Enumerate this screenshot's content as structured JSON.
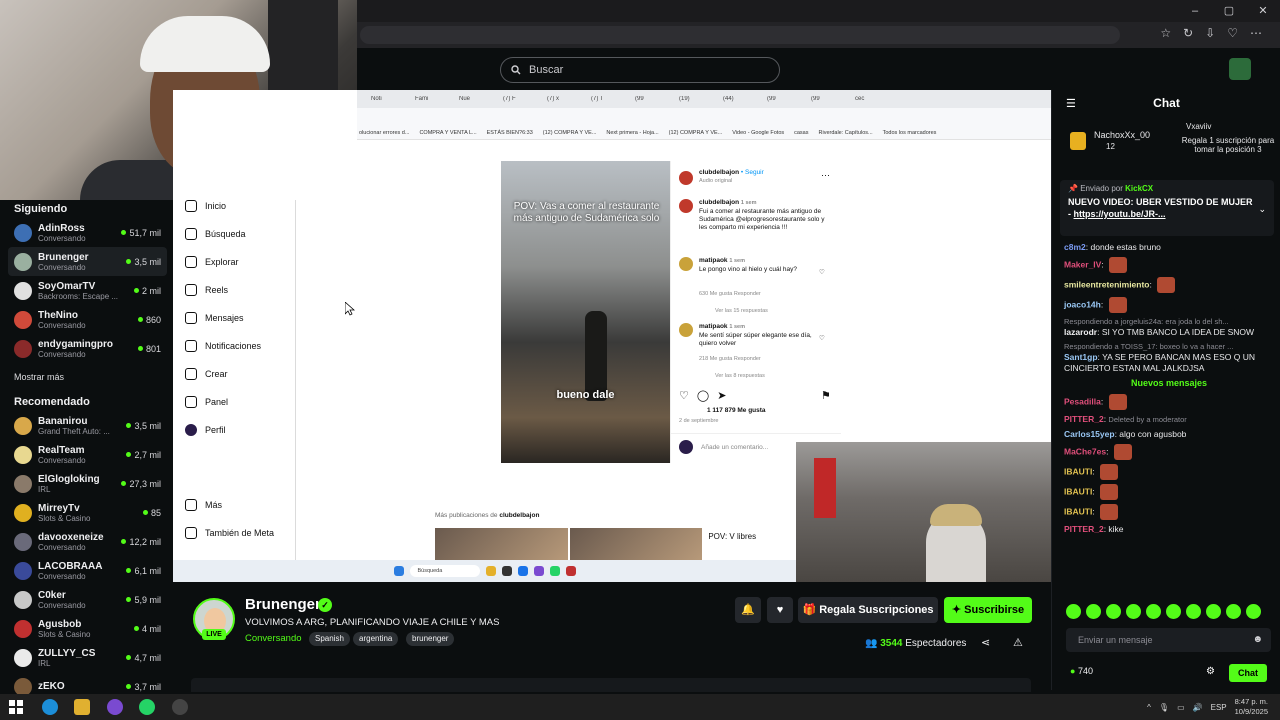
{
  "browser": {
    "window_controls": [
      "–",
      "▢",
      "✕"
    ],
    "toolbar_icons": [
      "☆",
      "↻",
      "⇩",
      "♡",
      "⋯"
    ]
  },
  "header": {
    "search_placeholder": "Buscar"
  },
  "sidebar": {
    "following_title": "Siguiendo",
    "following": [
      {
        "name": "AdinRoss",
        "category": "Conversando",
        "viewers": "51,7 mil",
        "color": "#3d6fb4"
      },
      {
        "name": "Brunenger",
        "category": "Conversando",
        "viewers": "3,5 mil",
        "color": "#9ab0a0"
      },
      {
        "name": "SoyOmarTV",
        "category": "Backrooms: Escape ...",
        "viewers": "2 mil",
        "color": "#e0e0e0"
      },
      {
        "name": "TheNino",
        "category": "Conversando",
        "viewers": "860",
        "color": "#d04a3a"
      },
      {
        "name": "endygamingpro",
        "category": "Conversando",
        "viewers": "801",
        "color": "#8a2a2a"
      }
    ],
    "show_more": "Mostrar más",
    "recommended_title": "Recomendado",
    "recommended": [
      {
        "name": "Bananirou",
        "category": "Grand Theft Auto: ...",
        "viewers": "3,5 mil",
        "color": "#d8a84a"
      },
      {
        "name": "RealTeam",
        "category": "Conversando",
        "viewers": "2,7 mil",
        "color": "#e8d890"
      },
      {
        "name": "ElGlogloking",
        "category": "IRL",
        "viewers": "27,3 mil",
        "color": "#8a7a6a"
      },
      {
        "name": "MirreyTv",
        "category": "Slots & Casino",
        "viewers": "85",
        "color": "#e0b020"
      },
      {
        "name": "davooxeneize",
        "category": "Conversando",
        "viewers": "12,2 mil",
        "color": "#6a6a7a"
      },
      {
        "name": "LACOBRAAA",
        "category": "Conversando",
        "viewers": "6,1 mil",
        "color": "#3a4a9a"
      },
      {
        "name": "C0ker",
        "category": "Conversando",
        "viewers": "5,9 mil",
        "color": "#c8c8c8"
      },
      {
        "name": "Agusbob",
        "category": "Slots & Casino",
        "viewers": "4 mil",
        "color": "#c03030"
      },
      {
        "name": "ZULLYY_CS",
        "category": "IRL",
        "viewers": "4,7 mil",
        "color": "#eaeaea"
      },
      {
        "name": "zEKO",
        "category": "",
        "viewers": "3,7 mil",
        "color": "#7a5a3a"
      }
    ]
  },
  "instagram": {
    "tabs": [
      "Noti",
      "Fami",
      "Nue",
      "(7) F",
      "(7) x",
      "(7) T",
      "(99",
      "(19)",
      "(44)",
      "(99",
      "(99",
      "cec"
    ],
    "bookmarks": [
      "olucionar errores d...",
      "COMPRA Y VENTA L...",
      "ESTÁS BIEN?6:33",
      "(12) COMPRA Y VE...",
      "Next primera - Hoja...",
      "(12) COMPRA Y VE...",
      "Video - Google Fotos",
      "casas",
      "Riverdale: Capítulos...",
      "Todos los marcadores"
    ],
    "nav": [
      "Inicio",
      "Búsqueda",
      "Explorar",
      "Reels",
      "Mensajes",
      "Notificaciones",
      "Crear",
      "Panel",
      "Perfil",
      "Más",
      "También de Meta"
    ],
    "reel_caption": "POV: Vas a comer al restaurante más antiguo de Sudamérica solo",
    "reel_subtitle": "bueno dale",
    "post": {
      "account": "clubdelbajon",
      "follow": "Seguir",
      "audio": "Audio original",
      "c1_user": "clubdelbajon",
      "c1_time": "1 sem",
      "c1_text": "Fui a comer al restaurante más antiguo de Sudamérica @elprogresorestaurante solo y les comparto mi experiencia !!!",
      "c2_user": "matipaok",
      "c2_time": "1 sem",
      "c2_text": "Le pongo vino al hielo y cuál hay?",
      "c2_meta": "630 Me gusta     Responder",
      "c2_replies": "Ver las 15 respuestas",
      "c3_user": "matipaok",
      "c3_time": "1 sem",
      "c3_text": "Me sentí súper súper elegante ese día, quiero volver",
      "c3_meta": "218 Me gusta     Responder",
      "c3_replies": "Ver las 8 respuestas",
      "likes": "1 117 879 Me gusta",
      "date": "2 de septiembre",
      "add_comment": "Añade un comentario..."
    },
    "more_posts_prefix": "Más publicaciones de",
    "more_posts_account": "clubdelbajon",
    "thumb_text": "POV: V libres",
    "taskbar_search": "Búsqueda"
  },
  "stream": {
    "name": "Brunenger",
    "live": "LIVE",
    "title": "VOLVIMOS A ARG, PLANIFICANDO VIAJE A CHILE Y MAS",
    "category": "Conversando",
    "tags": [
      "Spanish",
      "argentina",
      "brunenger"
    ],
    "gift_label": "Regala Suscripciones",
    "subscribe_label": "Suscribirse",
    "viewers_count": "3544",
    "viewers_label": "Espectadores"
  },
  "chat": {
    "title": "Chat",
    "top_gifter": {
      "name": "NachoxXx_00",
      "count": "12"
    },
    "gift_user": "Vxaviiv",
    "gift_text": "Regala 1 suscripción para tomar la posición 3",
    "pinned_by_label": "Enviado por",
    "pinned_by": "KickCX",
    "pinned_text": "NUEVO VIDEO: UBER VESTIDO DE MUJER -",
    "pinned_link": "https://youtu.be/JR-...",
    "messages": [
      {
        "user": "c8m2",
        "color": "#7b9cf5",
        "text": "donde estas bruno"
      },
      {
        "user": "Maker_IV",
        "color": "#e04f7b",
        "text": ""
      },
      {
        "user": "smileentretenimiento",
        "color": "#e8e8a0",
        "text": ""
      },
      {
        "user": "joaco14h",
        "color": "#9ac8f5",
        "text": ""
      },
      {
        "reply": "Respondiendo a jorgeluis24a: era joda lo del sh...",
        "user": "lazarodr",
        "color": "#efeff1",
        "text": "SI YO TMB BANCO LA IDEA DE SNOW"
      },
      {
        "reply": "Respondiendo a TOISS_17: boxeo lo va a hacer ...",
        "user": "Sant1gp",
        "color": "#9ac8f5",
        "text": "YA SE PERO BANCAN MAS ESO Q UN CINCIERTO ESTAN MAL JALKDJSA"
      }
    ],
    "new_messages": "Nuevos mensajes",
    "messages2": [
      {
        "user": "Pesadilla",
        "color": "#e04f7b",
        "text": ""
      },
      {
        "user": "PITTER_2",
        "color": "#e04f7b",
        "text": "Deleted by a moderator",
        "deleted": true
      },
      {
        "user": "Carlos15yep",
        "color": "#9ac8f5",
        "text": "algo con agusbob"
      },
      {
        "user": "MaChe7es",
        "color": "#e04f7b",
        "text": ""
      },
      {
        "user": "IBAUTI",
        "color": "#e0c050",
        "text": ""
      },
      {
        "user": "IBAUTI",
        "color": "#e0c050",
        "text": ""
      },
      {
        "user": "IBAUTI",
        "color": "#e0c050",
        "text": ""
      },
      {
        "user": "PITTER_2",
        "color": "#e04f7b",
        "text": "kike"
      }
    ],
    "input_placeholder": "Enviar un mensaje",
    "points": "740",
    "send_label": "Chat"
  },
  "windows": {
    "language": "ESP",
    "time": "8:47 p. m.",
    "date": "10/9/2025"
  },
  "cursor": {
    "visible": true
  }
}
